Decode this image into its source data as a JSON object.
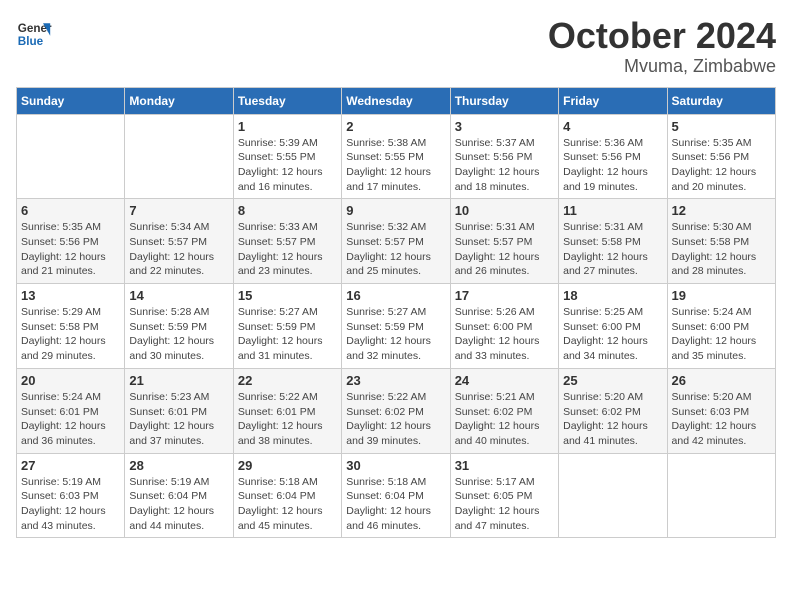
{
  "header": {
    "logo_line1": "General",
    "logo_line2": "Blue",
    "title": "October 2024",
    "subtitle": "Mvuma, Zimbabwe"
  },
  "days_of_week": [
    "Sunday",
    "Monday",
    "Tuesday",
    "Wednesday",
    "Thursday",
    "Friday",
    "Saturday"
  ],
  "weeks": [
    [
      {
        "day": "",
        "info": ""
      },
      {
        "day": "",
        "info": ""
      },
      {
        "day": "1",
        "info": "Sunrise: 5:39 AM\nSunset: 5:55 PM\nDaylight: 12 hours and 16 minutes."
      },
      {
        "day": "2",
        "info": "Sunrise: 5:38 AM\nSunset: 5:55 PM\nDaylight: 12 hours and 17 minutes."
      },
      {
        "day": "3",
        "info": "Sunrise: 5:37 AM\nSunset: 5:56 PM\nDaylight: 12 hours and 18 minutes."
      },
      {
        "day": "4",
        "info": "Sunrise: 5:36 AM\nSunset: 5:56 PM\nDaylight: 12 hours and 19 minutes."
      },
      {
        "day": "5",
        "info": "Sunrise: 5:35 AM\nSunset: 5:56 PM\nDaylight: 12 hours and 20 minutes."
      }
    ],
    [
      {
        "day": "6",
        "info": "Sunrise: 5:35 AM\nSunset: 5:56 PM\nDaylight: 12 hours and 21 minutes."
      },
      {
        "day": "7",
        "info": "Sunrise: 5:34 AM\nSunset: 5:57 PM\nDaylight: 12 hours and 22 minutes."
      },
      {
        "day": "8",
        "info": "Sunrise: 5:33 AM\nSunset: 5:57 PM\nDaylight: 12 hours and 23 minutes."
      },
      {
        "day": "9",
        "info": "Sunrise: 5:32 AM\nSunset: 5:57 PM\nDaylight: 12 hours and 25 minutes."
      },
      {
        "day": "10",
        "info": "Sunrise: 5:31 AM\nSunset: 5:57 PM\nDaylight: 12 hours and 26 minutes."
      },
      {
        "day": "11",
        "info": "Sunrise: 5:31 AM\nSunset: 5:58 PM\nDaylight: 12 hours and 27 minutes."
      },
      {
        "day": "12",
        "info": "Sunrise: 5:30 AM\nSunset: 5:58 PM\nDaylight: 12 hours and 28 minutes."
      }
    ],
    [
      {
        "day": "13",
        "info": "Sunrise: 5:29 AM\nSunset: 5:58 PM\nDaylight: 12 hours and 29 minutes."
      },
      {
        "day": "14",
        "info": "Sunrise: 5:28 AM\nSunset: 5:59 PM\nDaylight: 12 hours and 30 minutes."
      },
      {
        "day": "15",
        "info": "Sunrise: 5:27 AM\nSunset: 5:59 PM\nDaylight: 12 hours and 31 minutes."
      },
      {
        "day": "16",
        "info": "Sunrise: 5:27 AM\nSunset: 5:59 PM\nDaylight: 12 hours and 32 minutes."
      },
      {
        "day": "17",
        "info": "Sunrise: 5:26 AM\nSunset: 6:00 PM\nDaylight: 12 hours and 33 minutes."
      },
      {
        "day": "18",
        "info": "Sunrise: 5:25 AM\nSunset: 6:00 PM\nDaylight: 12 hours and 34 minutes."
      },
      {
        "day": "19",
        "info": "Sunrise: 5:24 AM\nSunset: 6:00 PM\nDaylight: 12 hours and 35 minutes."
      }
    ],
    [
      {
        "day": "20",
        "info": "Sunrise: 5:24 AM\nSunset: 6:01 PM\nDaylight: 12 hours and 36 minutes."
      },
      {
        "day": "21",
        "info": "Sunrise: 5:23 AM\nSunset: 6:01 PM\nDaylight: 12 hours and 37 minutes."
      },
      {
        "day": "22",
        "info": "Sunrise: 5:22 AM\nSunset: 6:01 PM\nDaylight: 12 hours and 38 minutes."
      },
      {
        "day": "23",
        "info": "Sunrise: 5:22 AM\nSunset: 6:02 PM\nDaylight: 12 hours and 39 minutes."
      },
      {
        "day": "24",
        "info": "Sunrise: 5:21 AM\nSunset: 6:02 PM\nDaylight: 12 hours and 40 minutes."
      },
      {
        "day": "25",
        "info": "Sunrise: 5:20 AM\nSunset: 6:02 PM\nDaylight: 12 hours and 41 minutes."
      },
      {
        "day": "26",
        "info": "Sunrise: 5:20 AM\nSunset: 6:03 PM\nDaylight: 12 hours and 42 minutes."
      }
    ],
    [
      {
        "day": "27",
        "info": "Sunrise: 5:19 AM\nSunset: 6:03 PM\nDaylight: 12 hours and 43 minutes."
      },
      {
        "day": "28",
        "info": "Sunrise: 5:19 AM\nSunset: 6:04 PM\nDaylight: 12 hours and 44 minutes."
      },
      {
        "day": "29",
        "info": "Sunrise: 5:18 AM\nSunset: 6:04 PM\nDaylight: 12 hours and 45 minutes."
      },
      {
        "day": "30",
        "info": "Sunrise: 5:18 AM\nSunset: 6:04 PM\nDaylight: 12 hours and 46 minutes."
      },
      {
        "day": "31",
        "info": "Sunrise: 5:17 AM\nSunset: 6:05 PM\nDaylight: 12 hours and 47 minutes."
      },
      {
        "day": "",
        "info": ""
      },
      {
        "day": "",
        "info": ""
      }
    ]
  ]
}
